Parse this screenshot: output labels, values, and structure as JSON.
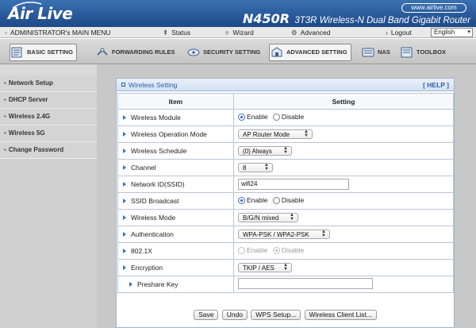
{
  "brand": {
    "logo_text": "Air Live",
    "site": "www.airlive.com",
    "model": "N450R",
    "model_desc": "3T3R Wireless-N Dual Band Gigabit Router"
  },
  "menu": {
    "admin": "ADMINISTRATOR's MAIN MENU",
    "status": "Status",
    "wizard": "Wizard",
    "advanced": "Advanced",
    "logout": "Logout",
    "language": "English"
  },
  "tabs": [
    {
      "label": "BASIC SETTING",
      "icon": "basic-setting-icon"
    },
    {
      "label": "FORWARDING RULES",
      "icon": "forwarding-icon"
    },
    {
      "label": "SECURITY SETTING",
      "icon": "security-icon"
    },
    {
      "label": "ADVANCED SETTING",
      "icon": "advanced-setting-icon"
    },
    {
      "label": "NAS",
      "icon": "nas-icon"
    },
    {
      "label": "TOOLBOX",
      "icon": "toolbox-icon"
    }
  ],
  "sidebar": {
    "items": [
      {
        "label": "Network Setup"
      },
      {
        "label": "DHCP Server"
      },
      {
        "label": "Wireless 2.4G"
      },
      {
        "label": "Wireless 5G"
      },
      {
        "label": "Change Password"
      }
    ]
  },
  "panel": {
    "title": "Wireless Setting",
    "help": "[ HELP ]",
    "col_item": "Item",
    "col_setting": "Setting"
  },
  "rows": {
    "module": {
      "label": "Wireless Module",
      "opt1": "Enable",
      "opt2": "Disable",
      "selected": "Enable"
    },
    "op_mode": {
      "label": "Wireless Operation Mode",
      "value": "AP Router Mode"
    },
    "schedule": {
      "label": "Wireless Schedule",
      "value": "(0) Always"
    },
    "channel": {
      "label": "Channel",
      "value": "8"
    },
    "ssid": {
      "label": "Network ID(SSID)",
      "value": "wifi24"
    },
    "broadcast": {
      "label": "SSID Broadcast",
      "opt1": "Enable",
      "opt2": "Disable",
      "selected": "Enable"
    },
    "mode": {
      "label": "Wireless Mode",
      "value": "B/G/N mixed"
    },
    "auth": {
      "label": "Authentication",
      "value": "WPA-PSK / WPA2-PSK"
    },
    "x8021": {
      "label": "802.1X",
      "opt1": "Enable",
      "opt2": "Disable",
      "selected": "Disable",
      "disabled": true
    },
    "encryption": {
      "label": "Encryption",
      "value": "TKIP / AES"
    },
    "preshare": {
      "label": "Preshare Key",
      "value": ""
    }
  },
  "buttons": {
    "save": "Save",
    "undo": "Undo",
    "wps": "WPS Setup...",
    "client_list": "Wireless Client List..."
  },
  "colors": {
    "banner": "#2a5a9a",
    "accent": "#2e5ea6",
    "sidebar": "#cfcfcf",
    "main_bg": "#c8c8c8"
  }
}
